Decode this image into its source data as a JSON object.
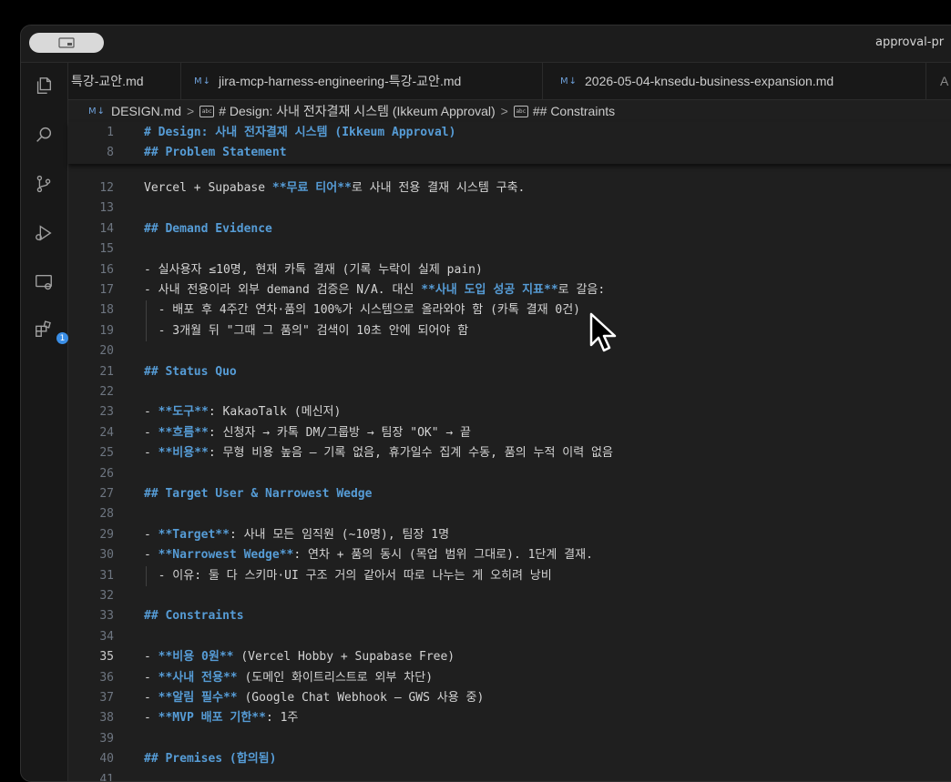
{
  "window": {
    "title": "approval-pr"
  },
  "tabs": [
    {
      "badge": "",
      "label": "특강-교안.md"
    },
    {
      "badge": "M↓",
      "label": "jira-mcp-harness-engineering-특강-교안.md"
    },
    {
      "badge": "M↓",
      "label": "2026-05-04-knsedu-business-expansion.md"
    },
    {
      "badge": "A",
      "label": ""
    }
  ],
  "breadcrumb": {
    "badge": "M↓",
    "file": "DESIGN.md",
    "sep": ">",
    "symbol_icon_text": "abc",
    "section1": "# Design: 사내 전자결재 시스템 (Ikkeum Approval)",
    "section2": "## Constraints"
  },
  "sticky_lines": [
    {
      "n": "1",
      "text": "# Design: 사내 전자결재 시스템 (Ikkeum Approval)"
    },
    {
      "n": "8",
      "text": "## Problem Statement"
    }
  ],
  "lines": [
    {
      "n": "12",
      "text": "Vercel + Supabase **무료 티어**로 사내 전용 결재 시스템 구축."
    },
    {
      "n": "13",
      "text": ""
    },
    {
      "n": "14",
      "text": "## Demand Evidence"
    },
    {
      "n": "15",
      "text": ""
    },
    {
      "n": "16",
      "text": "- 실사용자 ≤10명, 현재 카톡 결재 (기록 누락이 실제 pain)"
    },
    {
      "n": "17",
      "text": "- 사내 전용이라 외부 demand 검증은 N/A. 대신 **사내 도입 성공 지표**로 갈음:"
    },
    {
      "n": "18",
      "text": "  - 배포 후 4주간 연차·품의 100%가 시스템으로 올라와야 함 (카톡 결재 0건)"
    },
    {
      "n": "19",
      "text": "  - 3개월 뒤 \"그때 그 품의\" 검색이 10초 안에 되어야 함"
    },
    {
      "n": "20",
      "text": ""
    },
    {
      "n": "21",
      "text": "## Status Quo"
    },
    {
      "n": "22",
      "text": ""
    },
    {
      "n": "23",
      "text": "- **도구**: KakaoTalk (메신저)"
    },
    {
      "n": "24",
      "text": "- **흐름**: 신청자 → 카톡 DM/그룹방 → 팀장 \"OK\" → 끝"
    },
    {
      "n": "25",
      "text": "- **비용**: 무형 비용 높음 — 기록 없음, 휴가일수 집계 수동, 품의 누적 이력 없음"
    },
    {
      "n": "26",
      "text": ""
    },
    {
      "n": "27",
      "text": "## Target User & Narrowest Wedge"
    },
    {
      "n": "28",
      "text": ""
    },
    {
      "n": "29",
      "text": "- **Target**: 사내 모든 임직원 (~10명), 팀장 1명"
    },
    {
      "n": "30",
      "text": "- **Narrowest Wedge**: 연차 + 품의 동시 (목업 범위 그대로). 1단계 결재."
    },
    {
      "n": "31",
      "text": "  - 이유: 둘 다 스키마·UI 구조 거의 같아서 따로 나누는 게 오히려 낭비"
    },
    {
      "n": "32",
      "text": ""
    },
    {
      "n": "33",
      "text": "## Constraints"
    },
    {
      "n": "34",
      "text": ""
    },
    {
      "n": "35",
      "text": "- **비용 0원** (Vercel Hobby + Supabase Free)"
    },
    {
      "n": "36",
      "text": "- **사내 전용** (도메인 화이트리스트로 외부 차단)"
    },
    {
      "n": "37",
      "text": "- **알림 필수** (Google Chat Webhook — GWS 사용 중)"
    },
    {
      "n": "38",
      "text": "- **MVP 배포 기한**: 1주"
    },
    {
      "n": "39",
      "text": ""
    },
    {
      "n": "40",
      "text": "## Premises (합의됨)"
    },
    {
      "n": "41",
      "text": ""
    }
  ],
  "active_line": "35",
  "activity_badge": "1",
  "icons": [
    "explorer-icon",
    "search-icon",
    "source-control-icon",
    "run-debug-icon",
    "remote-explorer-icon",
    "extensions-icon"
  ],
  "colors": {
    "heading": "#569cd6",
    "text": "#d4d4d4",
    "line_number": "#6e7681",
    "background": "#1f1f1f"
  }
}
